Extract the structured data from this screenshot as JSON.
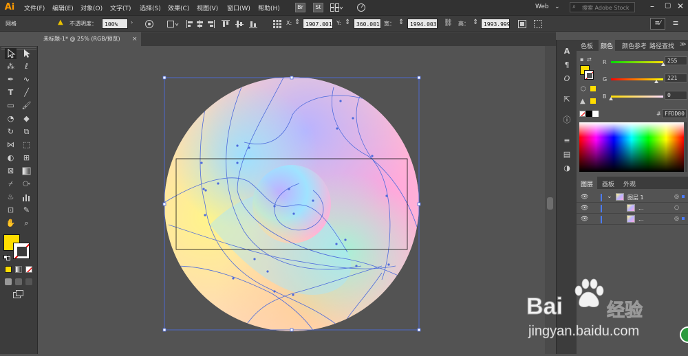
{
  "app": {
    "logo": "Ai",
    "workspace": "Web",
    "search_placeholder": "搜索 Adobe Stock"
  },
  "menu": [
    "文件(F)",
    "编辑(E)",
    "对象(O)",
    "文字(T)",
    "选择(S)",
    "效果(C)",
    "视图(V)",
    "窗口(W)",
    "帮助(H)"
  ],
  "menu_icons": {
    "bridge": "Br",
    "stock": "St"
  },
  "control": {
    "object_type": "网格",
    "opacity_label": "不透明度：",
    "opacity_value": "100%",
    "x_label": "X:",
    "x_value": "1907.001",
    "y_label": "Y:",
    "y_value": "360.001",
    "w_label": "宽：",
    "w_value": "1994.003",
    "h_label": "高：",
    "h_value": "1993.999"
  },
  "document": {
    "tab_title": "未标题-1* @ 25% (RGB/预览)",
    "close": "×"
  },
  "color_panel": {
    "tabs": [
      "色板",
      "颜色",
      "颜色参考",
      "路径查找"
    ],
    "active_tab": "颜色",
    "channels": [
      {
        "label": "R",
        "value": "255",
        "level": 1.0
      },
      {
        "label": "G",
        "value": "221",
        "level": 0.867
      },
      {
        "label": "B",
        "value": "0",
        "level": 0.0
      }
    ],
    "hex_label": "#",
    "hex_value": "FFDD00",
    "fill_color": "#FFDD00"
  },
  "layers_panel": {
    "tabs": [
      "图层",
      "画板",
      "外观"
    ],
    "active_tab": "图层",
    "rows": [
      {
        "name": "图层 1"
      },
      {
        "name": "..."
      },
      {
        "name": "..."
      }
    ]
  },
  "toolbox": {
    "icons": [
      "selection-icon",
      "direct-selection-icon",
      "magic-wand-icon",
      "lasso-icon",
      "pen-icon",
      "curvature-icon",
      "type-icon",
      "line-icon",
      "rectangle-icon",
      "paintbrush-icon",
      "shaper-icon",
      "eraser-icon",
      "rotate-icon",
      "scale-icon",
      "width-icon",
      "free-transform-icon",
      "shape-builder-icon",
      "perspective-icon",
      "mesh-icon",
      "gradient-icon",
      "eyedropper-icon",
      "blend-icon",
      "symbol-sprayer-icon",
      "graph-icon",
      "artboard-icon",
      "slice-icon",
      "hand-icon",
      "zoom-icon"
    ],
    "fill_color": "#FFDD00"
  },
  "watermark": {
    "brand": "Bai",
    "brand_cn": "经验",
    "url": "jingyan.baidu.com"
  }
}
